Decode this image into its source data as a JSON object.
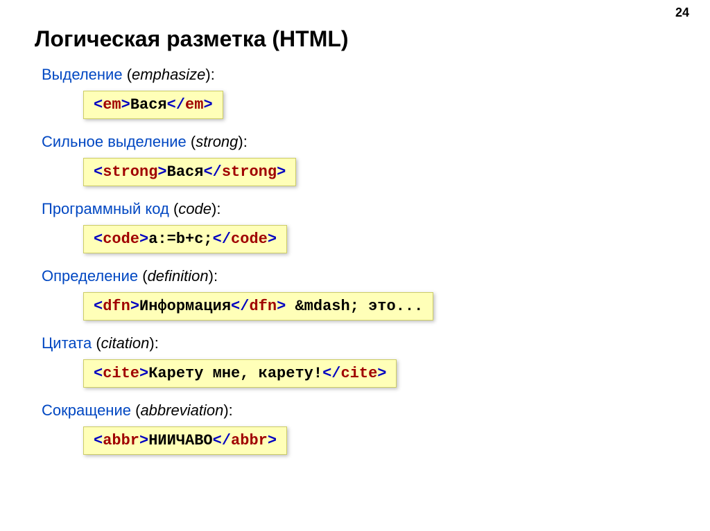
{
  "pageNumber": "24",
  "title": "Логическая разметка (HTML)",
  "sections": [
    {
      "labelRu": "Выделение",
      "labelEn": "emphasize",
      "openAngle1": "<",
      "tag1": "em",
      "closeAngle1": ">",
      "content1": "Вася",
      "openAngle2": "</",
      "tag2": "em",
      "closeAngle2": ">",
      "extra": ""
    },
    {
      "labelRu": "Сильное выделение",
      "labelEn": "strong",
      "openAngle1": "<",
      "tag1": "strong",
      "closeAngle1": ">",
      "content1": "Вася",
      "openAngle2": "</",
      "tag2": "strong",
      "closeAngle2": ">",
      "extra": ""
    },
    {
      "labelRu": "Программный код",
      "labelEn": "code",
      "openAngle1": "<",
      "tag1": "code",
      "closeAngle1": ">",
      "content1": "a:=b+c;",
      "openAngle2": "</",
      "tag2": "code",
      "closeAngle2": ">",
      "extra": ""
    },
    {
      "labelRu": "Определение",
      "labelEn": "definition",
      "openAngle1": "<",
      "tag1": "dfn",
      "closeAngle1": ">",
      "content1": "Информация",
      "openAngle2": "</",
      "tag2": "dfn",
      "closeAngle2": ">",
      "extra": " &mdash; это..."
    },
    {
      "labelRu": "Цитата",
      "labelEn": "citation",
      "openAngle1": "<",
      "tag1": "cite",
      "closeAngle1": ">",
      "content1": "Карету мне, карету!",
      "openAngle2": "</",
      "tag2": "cite",
      "closeAngle2": ">",
      "extra": ""
    },
    {
      "labelRu": "Сокращение",
      "labelEn": "abbreviation",
      "openAngle1": "<",
      "tag1": "abbr",
      "closeAngle1": ">",
      "content1": "НИИЧАВО",
      "openAngle2": "</",
      "tag2": "abbr",
      "closeAngle2": ">",
      "extra": ""
    }
  ]
}
